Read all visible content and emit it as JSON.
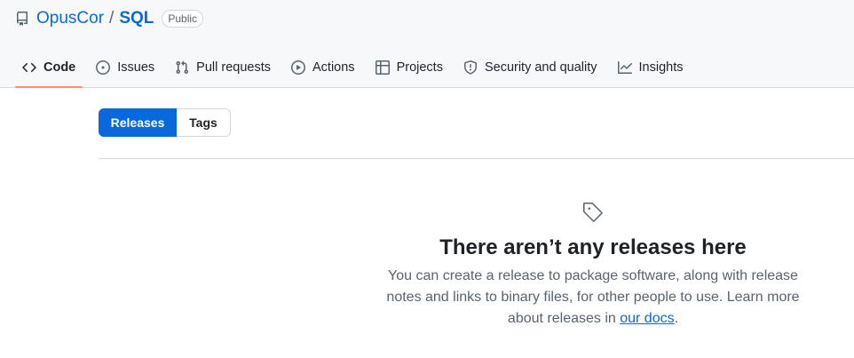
{
  "repo": {
    "owner": "OpusCor",
    "separator": "/",
    "name": "SQL",
    "visibility": "Public"
  },
  "tabs": [
    {
      "label": "Code",
      "icon": "code-icon",
      "selected": true
    },
    {
      "label": "Issues",
      "icon": "issue-opened-icon",
      "selected": false
    },
    {
      "label": "Pull requests",
      "icon": "git-pull-request-icon",
      "selected": false
    },
    {
      "label": "Actions",
      "icon": "play-icon",
      "selected": false
    },
    {
      "label": "Projects",
      "icon": "table-icon",
      "selected": false
    },
    {
      "label": "Security and quality",
      "icon": "shield-icon",
      "selected": false
    },
    {
      "label": "Insights",
      "icon": "graph-icon",
      "selected": false
    }
  ],
  "toggle": {
    "releases": "Releases",
    "tags": "Tags",
    "active": "Releases"
  },
  "empty_state": {
    "icon": "tag-icon",
    "title": "There aren’t any releases here",
    "body_before": "You can create a release to package software, along with release notes and links to binary files, for other people to use. Learn more about releases in ",
    "link_text": "our docs",
    "body_after": "."
  },
  "colors": {
    "accent": "#0969da",
    "selected_underline": "#fd8c73",
    "muted_text": "#59636e",
    "border": "#d1d9e0"
  }
}
